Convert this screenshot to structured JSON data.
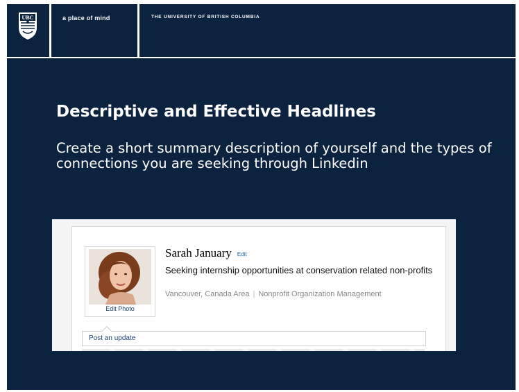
{
  "header": {
    "logo_text": "UBC",
    "tagline": "a place of mind",
    "university": "THE UNIVERSITY OF BRITISH COLUMBIA"
  },
  "slide": {
    "title": "Descriptive and Effective Headlines",
    "body": "Create a short summary description of yourself and the types of connections you are seeking through Linkedin"
  },
  "profile": {
    "name": "Sarah January",
    "name_edit": "Edit",
    "headline": "Seeking internship opportunities at conservation related non-profits",
    "location": "Vancouver, Canada Area",
    "industry": "Nonprofit Organization Management",
    "edit_photo": "Edit Photo",
    "post_update": "Post an update"
  },
  "colors": {
    "slide_background": "#0c2340",
    "header_text": "#ffffff",
    "link": "#1b3f72",
    "edit_link": "#1e64a8"
  },
  "icons": [
    "ubc-crest-icon",
    "profile-photo"
  ]
}
